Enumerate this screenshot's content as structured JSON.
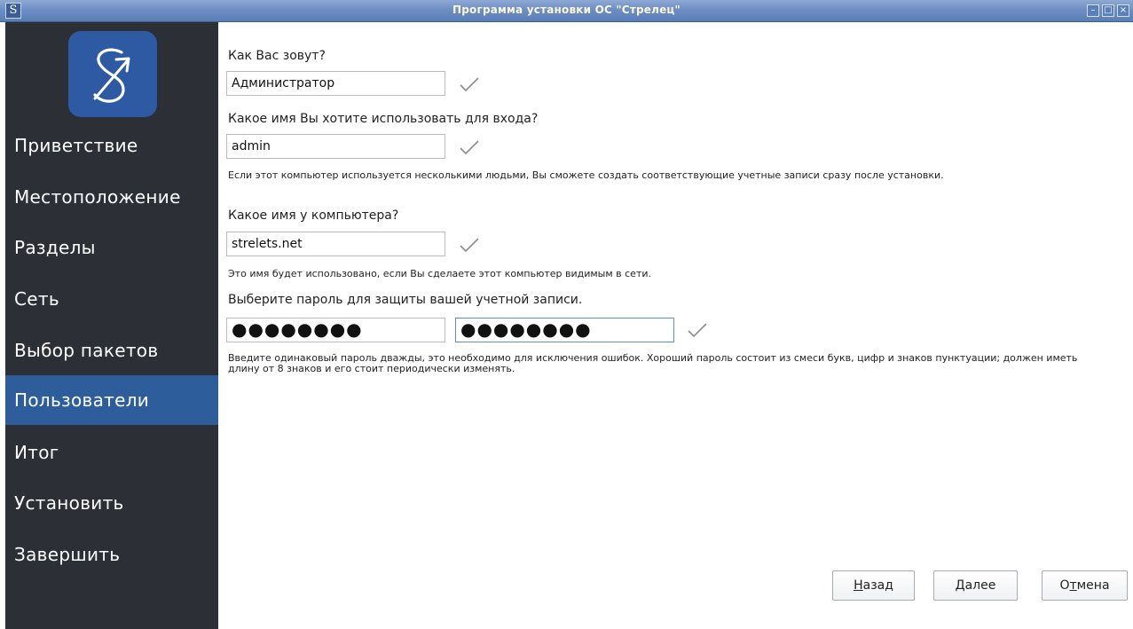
{
  "window": {
    "title": "Программа установки ОС \"Стрелец\"",
    "icon": "strelets-logo-icon",
    "buttons": [
      "minimize-icon",
      "maximize-icon",
      "close-icon"
    ]
  },
  "sidebar": {
    "logo": "strelets-logo",
    "items": [
      {
        "label": "Приветствие",
        "active": false
      },
      {
        "label": "Местоположение",
        "active": false
      },
      {
        "label": "Разделы",
        "active": false
      },
      {
        "label": "Сеть",
        "active": false
      },
      {
        "label": "Выбор пакетов",
        "active": false
      },
      {
        "label": "Пользователи",
        "active": true
      },
      {
        "label": "Итог",
        "active": false
      },
      {
        "label": "Установить",
        "active": false
      },
      {
        "label": "Завершить",
        "active": false
      }
    ],
    "active_color": "#2e5d9c",
    "background_color": "#2c3036"
  },
  "form": {
    "name_label": "Как Вас зовут?",
    "name_value": "Администратор",
    "login_label": "Какое имя Вы хотите использовать для входа?",
    "login_value": "admin",
    "login_hint": "Если этот компьютер используется несколькими людьми, Вы сможете создать соответствующие учетные записи сразу после установки.",
    "host_label": "Какое имя у компьютера?",
    "host_value": "strelets.net",
    "host_hint": "Это имя будет использовано, если Вы сделаете этот компьютер видимым в сети.",
    "password_label": "Выберите пароль для защиты вашей учетной записи.",
    "password_value": "●●●●●●●●",
    "password_confirm_value": "●●●●●●●●",
    "password_hint": "Введите одинаковый пароль дважды, это необходимо для исключения ошибок. Хороший пароль состоит из смеси букв, цифр и знаков пунктуации; должен иметь длину от 8 знаков и его стоит периодически изменять.",
    "check_icon": "checkmark-icon"
  },
  "buttons": {
    "back": {
      "mnemonic": "Н",
      "rest": "азад"
    },
    "next": {
      "mnemonic": "Д",
      "rest": "алее"
    },
    "cancel": {
      "pre": "О",
      "mnemonic": "т",
      "rest": "мена"
    }
  }
}
